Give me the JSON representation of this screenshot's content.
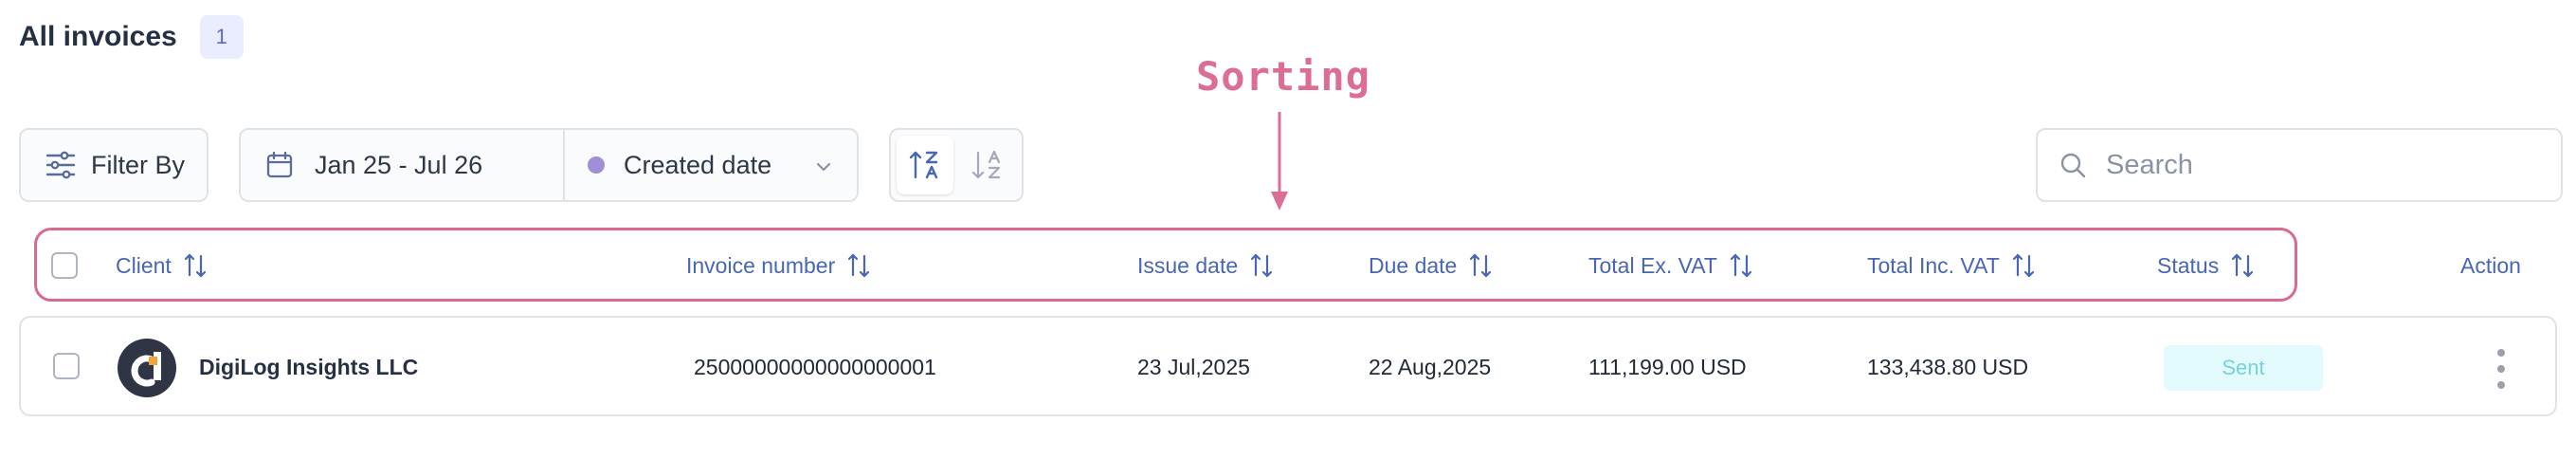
{
  "header": {
    "title": "All invoices",
    "count": "1"
  },
  "annotation": {
    "label": "Sorting",
    "color": "#dd6e93"
  },
  "toolbar": {
    "filter_label": "Filter By",
    "date_range": "Jan 25 - Jul 26",
    "sort_field": "Created date",
    "search_placeholder": "Search"
  },
  "table": {
    "columns": [
      "Client",
      "Invoice number",
      "Issue date",
      "Due date",
      "Total Ex. VAT",
      "Total Inc. VAT",
      "Status",
      "Action"
    ],
    "rows": [
      {
        "client": "DigiLog Insights LLC",
        "invoice_number": "25000000000000000001",
        "issue_date": "23 Jul,2025",
        "due_date": "22 Aug,2025",
        "total_ex_vat": "111,199.00 USD",
        "total_inc_vat": "133,438.80 USD",
        "status": "Sent"
      }
    ]
  },
  "colors": {
    "accent": "#4866b4",
    "status_sent_bg": "#e4fbfd",
    "status_sent_text": "#72d3dc",
    "highlight": "#d9698f"
  }
}
